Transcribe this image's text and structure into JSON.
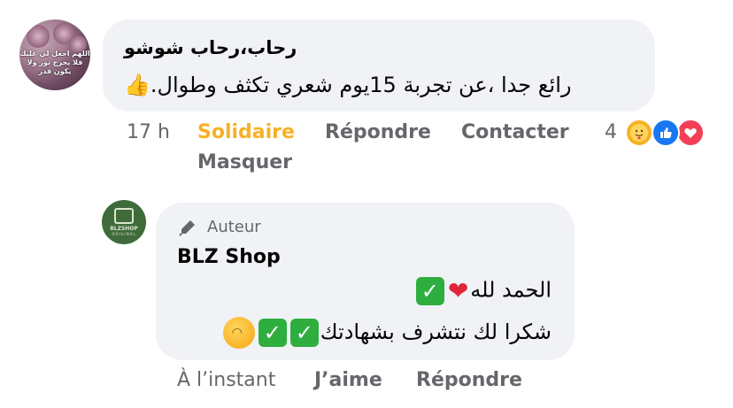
{
  "comment": {
    "avatar_text": "اللهم اجعل لي عليك فلا يخرج نور ولا يكون قدر",
    "author": "رحاب،رحاب شوشو",
    "text": "رائع جدا ،عن تجربة 15يوم شعري تكثف وطوال.",
    "emoji": "👍",
    "time": "17 h",
    "actions": {
      "solidaire": "Solidaire",
      "repondre": "Répondre",
      "contacter": "Contacter",
      "masquer": "Masquer"
    },
    "reaction_count": "4",
    "reactions": [
      "care",
      "like",
      "love"
    ]
  },
  "reply": {
    "avatar_label": "BLZSHOP",
    "avatar_sub": "ORIGINAL",
    "badge": "Auteur",
    "author": "BLZ Shop",
    "line1": "الحمد لله",
    "line2": "شكرا لك نتشرف بشهادتك",
    "time": "À l’instant",
    "actions": {
      "jaime": "J’aime",
      "repondre": "Répondre"
    }
  },
  "colors": {
    "bubble": "#f0f2f5",
    "meta": "#65676b",
    "solidaire": "#f7b125",
    "like": "#1877f2",
    "love": "#f33e58",
    "check": "#2eae3f"
  }
}
